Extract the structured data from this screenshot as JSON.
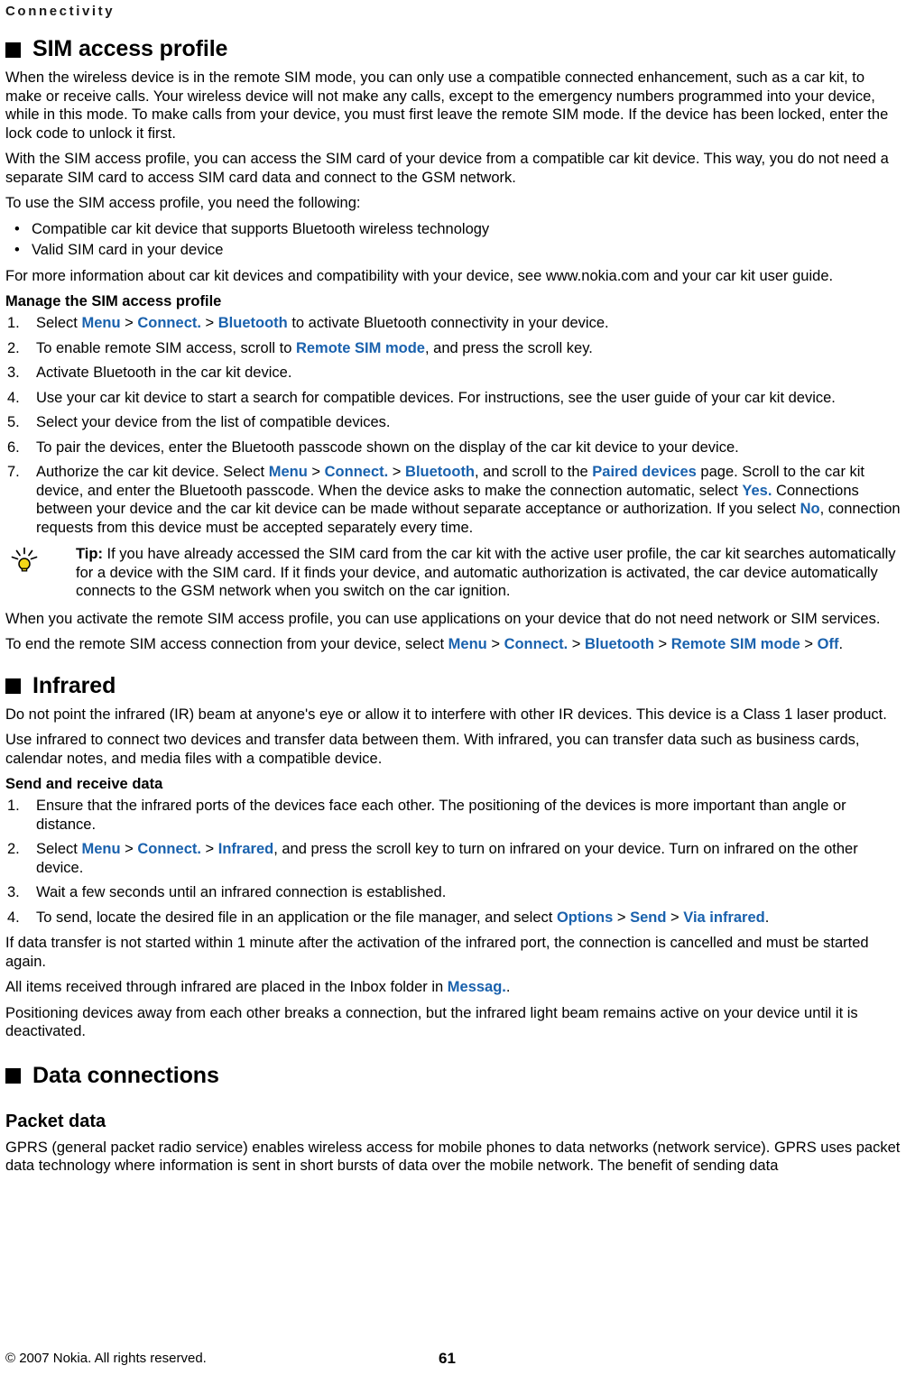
{
  "running_head": "Connectivity",
  "sections": {
    "sim": {
      "title": "SIM access profile",
      "marker": "black-square",
      "p1": "When the wireless device is in the remote SIM mode, you can only use a compatible connected enhancement, such as a car kit, to make or receive calls. Your wireless device will not make any calls, except to the emergency numbers programmed into your device, while in this mode. To make calls from your device, you must first leave the remote SIM mode. If the device has been locked, enter the lock code to unlock it first.",
      "p2": "With the SIM access profile, you can access the SIM card of your device from a compatible car kit device. This way, you do not need a separate SIM card to access SIM card data and connect to the GSM network.",
      "p3": "To use the SIM access profile, you need the following:",
      "bullets": [
        "Compatible car kit device that supports Bluetooth wireless technology",
        "Valid SIM card in your device"
      ],
      "p4": "For more information about car kit devices and compatibility with your device, see www.nokia.com and your car kit user guide.",
      "manage_head": "Manage the SIM access profile",
      "steps": [
        {
          "num": "1.",
          "parts": [
            {
              "t": "Select ",
              "s": "plain"
            },
            {
              "t": "Menu",
              "s": "ui"
            },
            {
              "t": " > ",
              "s": "gt"
            },
            {
              "t": "Connect.",
              "s": "ui"
            },
            {
              "t": " > ",
              "s": "gt"
            },
            {
              "t": "Bluetooth",
              "s": "ui"
            },
            {
              "t": " to activate Bluetooth connectivity in your device.",
              "s": "plain"
            }
          ]
        },
        {
          "num": "2.",
          "parts": [
            {
              "t": "To enable remote SIM access, scroll to ",
              "s": "plain"
            },
            {
              "t": "Remote SIM mode",
              "s": "ui"
            },
            {
              "t": ", and press the scroll key.",
              "s": "plain"
            }
          ]
        },
        {
          "num": "3.",
          "parts": [
            {
              "t": "Activate Bluetooth in the car kit device.",
              "s": "plain"
            }
          ]
        },
        {
          "num": "4.",
          "parts": [
            {
              "t": "Use your car kit device to start a search for compatible devices. For instructions, see the user guide of your car kit device.",
              "s": "plain"
            }
          ]
        },
        {
          "num": "5.",
          "parts": [
            {
              "t": "Select your device from the list of compatible devices.",
              "s": "plain"
            }
          ]
        },
        {
          "num": "6.",
          "parts": [
            {
              "t": "To pair the devices, enter the Bluetooth passcode shown on the display of the car kit device to your device.",
              "s": "plain"
            }
          ]
        },
        {
          "num": "7.",
          "parts": [
            {
              "t": "Authorize the car kit device. Select ",
              "s": "plain"
            },
            {
              "t": "Menu",
              "s": "ui"
            },
            {
              "t": " > ",
              "s": "gt"
            },
            {
              "t": "Connect.",
              "s": "ui"
            },
            {
              "t": " > ",
              "s": "gt"
            },
            {
              "t": "Bluetooth",
              "s": "ui"
            },
            {
              "t": ", and scroll to the ",
              "s": "plain"
            },
            {
              "t": "Paired devices",
              "s": "ui"
            },
            {
              "t": " page. Scroll to the car kit device, and enter the Bluetooth passcode. When the device asks to make the connection automatic, select ",
              "s": "plain"
            },
            {
              "t": "Yes.",
              "s": "ui"
            },
            {
              "t": " Connections between your device and the car kit device can be made without separate acceptance or authorization. If you select ",
              "s": "plain"
            },
            {
              "t": "No",
              "s": "ui"
            },
            {
              "t": ", connection requests from this device must be accepted separately every time.",
              "s": "plain"
            }
          ]
        }
      ],
      "tip": {
        "icon": "lightbulb-icon",
        "label": "Tip:",
        "text": " If you have already accessed the SIM card from the car kit with the active user profile, the car kit searches automatically for a device with the SIM card. If it finds your device, and automatic authorization is activated, the car device automatically connects to the GSM network when you switch on the car ignition."
      },
      "p5": "When you activate the remote SIM access profile, you can use applications on your device that do not need network or SIM services.",
      "p6_parts": [
        {
          "t": "To end the remote SIM access connection from your device, select ",
          "s": "plain"
        },
        {
          "t": "Menu",
          "s": "ui"
        },
        {
          "t": " > ",
          "s": "gt"
        },
        {
          "t": "Connect.",
          "s": "ui"
        },
        {
          "t": " > ",
          "s": "gt"
        },
        {
          "t": "Bluetooth",
          "s": "ui"
        },
        {
          "t": " > ",
          "s": "gt"
        },
        {
          "t": "Remote SIM mode",
          "s": "ui"
        },
        {
          "t": " > ",
          "s": "gt"
        },
        {
          "t": "Off",
          "s": "ui"
        },
        {
          "t": ".",
          "s": "plain"
        }
      ]
    },
    "infrared": {
      "title": "Infrared",
      "marker": "black-square",
      "p1": "Do not point the infrared (IR) beam at anyone's eye or allow it to interfere with other IR devices. This device is a Class 1 laser product.",
      "p2": "Use infrared to connect two devices and transfer data between them. With infrared, you can transfer data such as business cards, calendar notes, and media files with a compatible device.",
      "send_head": "Send and receive data",
      "steps": [
        {
          "num": "1.",
          "parts": [
            {
              "t": "Ensure that the infrared ports of the devices face each other. The positioning of the devices is more important than angle or distance.",
              "s": "plain"
            }
          ]
        },
        {
          "num": "2.",
          "parts": [
            {
              "t": "Select ",
              "s": "plain"
            },
            {
              "t": "Menu",
              "s": "ui"
            },
            {
              "t": " > ",
              "s": "gt"
            },
            {
              "t": "Connect.",
              "s": "ui"
            },
            {
              "t": " > ",
              "s": "gt"
            },
            {
              "t": "Infrared",
              "s": "ui"
            },
            {
              "t": ", and press the scroll key to turn on infrared on your device. Turn on infrared on the other device.",
              "s": "plain"
            }
          ]
        },
        {
          "num": "3.",
          "parts": [
            {
              "t": "Wait a few seconds until an infrared connection is established.",
              "s": "plain"
            }
          ]
        },
        {
          "num": "4.",
          "parts": [
            {
              "t": "To send, locate the desired file in an application or the file manager, and select ",
              "s": "plain"
            },
            {
              "t": "Options",
              "s": "ui"
            },
            {
              "t": " > ",
              "s": "gt"
            },
            {
              "t": "Send",
              "s": "ui"
            },
            {
              "t": " > ",
              "s": "gt"
            },
            {
              "t": "Via infrared",
              "s": "ui"
            },
            {
              "t": ".",
              "s": "plain"
            }
          ]
        }
      ],
      "p3": "If data transfer is not started within 1 minute after the activation of the infrared port, the connection is cancelled and must be started again.",
      "p4_parts": [
        {
          "t": "All items received through infrared are placed in the Inbox folder in ",
          "s": "plain"
        },
        {
          "t": "Messag.",
          "s": "ui"
        },
        {
          "t": ".",
          "s": "plain"
        }
      ],
      "p5": "Positioning devices away from each other breaks a connection, but the infrared light beam remains active on your device until it is deactivated."
    },
    "data_connections": {
      "title": "Data connections",
      "marker": "black-square",
      "packet_data_head": "Packet data",
      "p1": "GPRS (general packet radio service) enables wireless access for mobile phones to data networks (network service). GPRS uses packet data technology where information is sent in short bursts of data over the mobile network. The benefit of sending data"
    }
  },
  "footer": {
    "copyright": "© 2007 Nokia. All rights reserved.",
    "page_number": "61"
  },
  "colors": {
    "ui_term": "#1961ad",
    "text": "#000000",
    "bulb": "#f5d817",
    "background": "#ffffff"
  }
}
